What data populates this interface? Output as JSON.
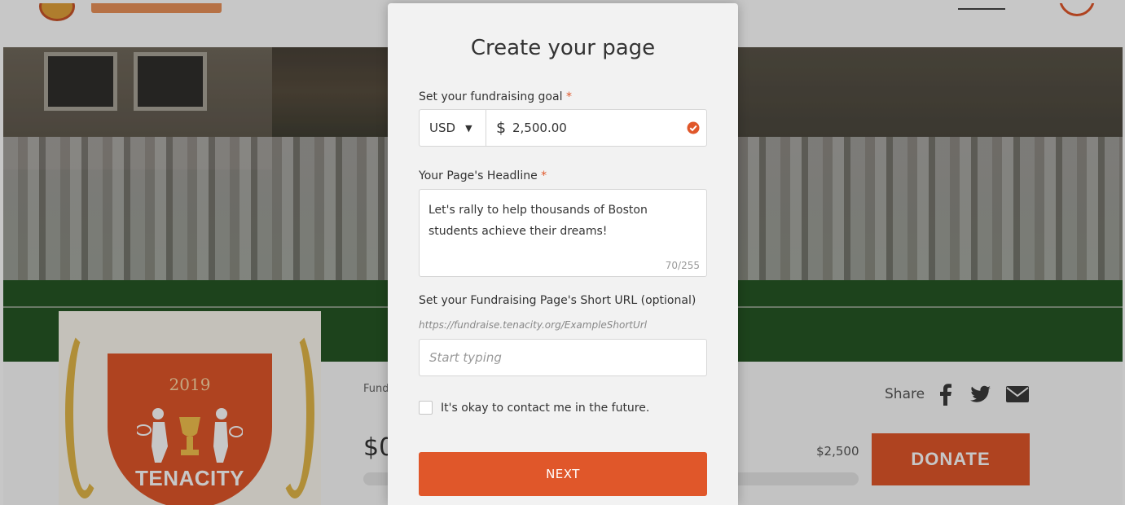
{
  "background": {
    "crest": {
      "year": "2019",
      "title": "TENACITY"
    },
    "fund_label": "Fund",
    "raised_amount": "$0",
    "goal_amount": "$2,500",
    "share_label": "Share",
    "donate_label": "DONATE",
    "share_icons": [
      "facebook-icon",
      "twitter-icon",
      "email-icon"
    ]
  },
  "modal": {
    "title": "Create your page",
    "goal": {
      "label": "Set your fundraising goal",
      "required_mark": "*",
      "currency": "USD",
      "currency_symbol": "$",
      "value": "2,500.00"
    },
    "headline": {
      "label": "Your Page's Headline",
      "required_mark": "*",
      "value": "Let's rally to help thousands of Boston students achieve their dreams!",
      "char_count": "70/255"
    },
    "short_url": {
      "label": "Set your Fundraising Page's Short URL (optional)",
      "hint": "https://fundraise.tenacity.org/ExampleShortUrl",
      "placeholder": "Start typing"
    },
    "contact_label": "It's okay to contact me in the future.",
    "next_label": "NEXT"
  },
  "colors": {
    "accent": "#e0572a",
    "modal_bg": "#f2f2f2",
    "crest_gold": "#e2b748"
  }
}
